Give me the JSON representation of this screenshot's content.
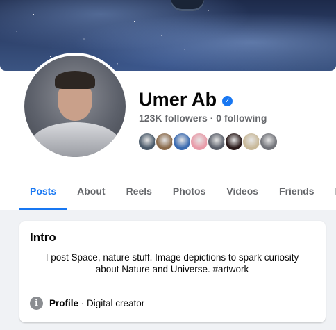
{
  "profile": {
    "name": "Umer Ab",
    "followers": "123K followers",
    "separator": "·",
    "following": "0 following",
    "verified_icon": "verified-badge-icon"
  },
  "follower_avatars": [
    {
      "color": "#4a5a6a"
    },
    {
      "color": "#8a6a4a"
    },
    {
      "color": "#3a6ab0"
    },
    {
      "color": "#e89aa8"
    },
    {
      "color": "#5a5f6a"
    },
    {
      "color": "#2a1a1a"
    },
    {
      "color": "#c8b898"
    },
    {
      "color": "#707278"
    }
  ],
  "tabs": [
    {
      "label": "Posts",
      "active": true
    },
    {
      "label": "About"
    },
    {
      "label": "Reels"
    },
    {
      "label": "Photos"
    },
    {
      "label": "Videos"
    },
    {
      "label": "Friends"
    },
    {
      "label": "Mo"
    }
  ],
  "intro": {
    "title": "Intro",
    "bio_line1": "I post Space, nature stuff. Image depictions to spark curiosity",
    "bio_line2": "about Nature and Universe. #artwork",
    "profile_label": "Profile",
    "profile_sep": " · ",
    "profile_type": "Digital creator",
    "info_icon": "info-icon"
  },
  "colors": {
    "accent": "#1877f2",
    "secondary_text": "#65676b",
    "feed_background": "#f0f2f5"
  }
}
